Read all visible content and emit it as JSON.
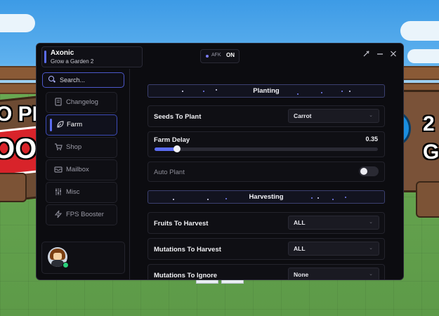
{
  "window": {
    "title": "Axonic",
    "subtitle": "Grow a Garden 2",
    "afk": {
      "label": "AFK",
      "state": "ON"
    },
    "accent_color": "#5b6cf0",
    "icons": [
      "settings-icon",
      "minimize-icon",
      "close-icon"
    ]
  },
  "sidebar": {
    "search_placeholder": "Search...",
    "items": [
      {
        "label": "Changelog",
        "icon": "changelog-icon"
      },
      {
        "label": "Farm",
        "icon": "leaf-icon",
        "active": true
      },
      {
        "label": "Shop",
        "icon": "cart-icon"
      },
      {
        "label": "Mailbox",
        "icon": "mailbox-icon"
      },
      {
        "label": "Misc",
        "icon": "sliders-icon"
      },
      {
        "label": "FPS Booster",
        "icon": "lightning-icon"
      }
    ]
  },
  "main": {
    "sections": [
      {
        "title": "Planting",
        "rows": [
          {
            "type": "dropdown",
            "label": "Seeds To Plant",
            "value": "Carrot"
          },
          {
            "type": "slider",
            "label": "Farm Delay",
            "value": "0.35",
            "fraction": 0.1
          },
          {
            "type": "toggle",
            "label": "Auto Plant",
            "on": false
          }
        ]
      },
      {
        "title": "Harvesting",
        "rows": [
          {
            "type": "dropdown",
            "label": "Fruits To Harvest",
            "value": "ALL"
          },
          {
            "type": "dropdown",
            "label": "Mutations To Harvest",
            "value": "ALL"
          },
          {
            "type": "dropdown",
            "label": "Mutations To Ignore",
            "value": "None"
          }
        ]
      }
    ]
  },
  "background": {
    "sign_left_text": "O PL",
    "sign_left_text_2": "OO",
    "sign_right_text": "2",
    "sign_right_text_2": "G"
  }
}
